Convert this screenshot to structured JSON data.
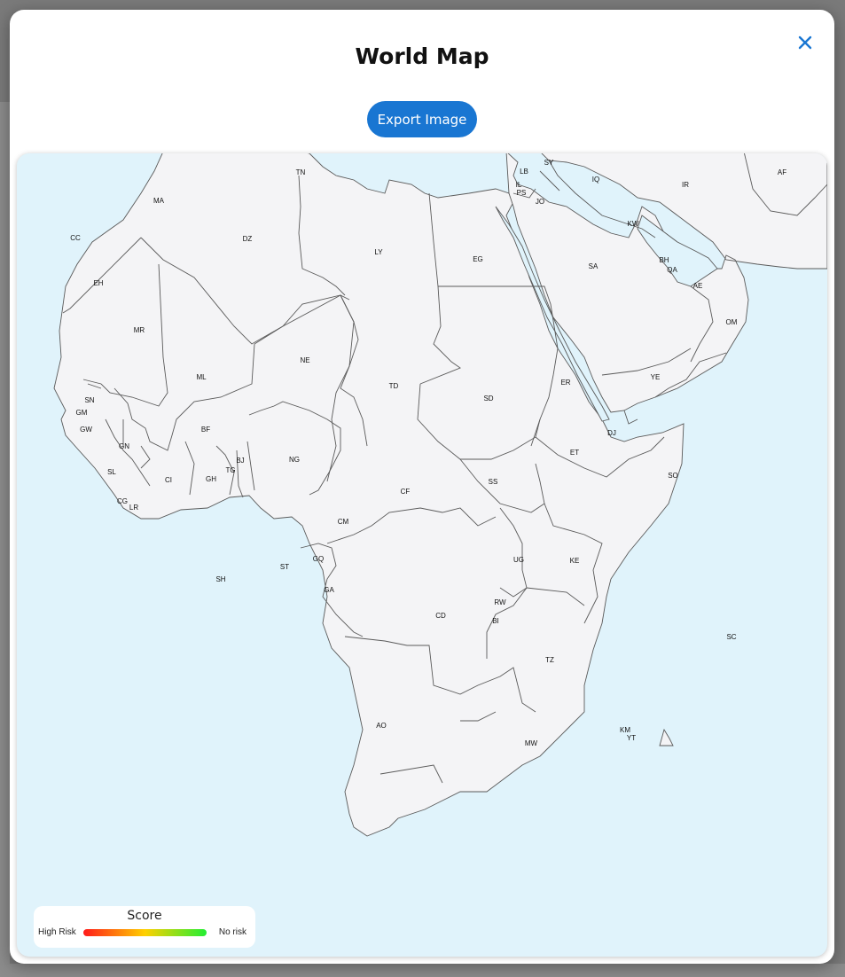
{
  "modal": {
    "title": "World Map",
    "close_icon": "close-icon",
    "export_label": "Export Image",
    "accent_color": "#1976d2"
  },
  "map": {
    "land_color": "#f4f4f6",
    "ocean_color": "#e0f3fb",
    "border_color": "#5a5a5a",
    "country_codes": [
      "TN",
      "MA",
      "CC",
      "DZ",
      "LY",
      "EG",
      "LB",
      "SY",
      "IL",
      "PS",
      "JO",
      "IQ",
      "IR",
      "AF",
      "KW",
      "SA",
      "BH",
      "QA",
      "AE",
      "OM",
      "YE",
      "EH",
      "MR",
      "ML",
      "NE",
      "TD",
      "SD",
      "ER",
      "DJ",
      "ET",
      "SO",
      "SN",
      "GM",
      "GW",
      "GN",
      "SL",
      "LR",
      "CI",
      "GH",
      "TG",
      "BJ",
      "BF",
      "NG",
      "CM",
      "CF",
      "SS",
      "UG",
      "KE",
      "GQ",
      "ST",
      "GA",
      "CD",
      "RW",
      "BI",
      "TZ",
      "AO",
      "MW",
      "KM",
      "YT",
      "SC",
      "SH",
      "CG"
    ]
  },
  "legend": {
    "title": "Score",
    "low_label": "High Risk",
    "high_label": "No risk",
    "gradient": [
      "#ff1a1a",
      "#ffd000",
      "#22ee33"
    ]
  }
}
